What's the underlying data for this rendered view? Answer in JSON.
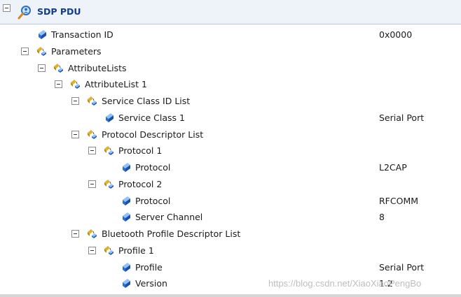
{
  "header": {
    "title": "SDP PDU"
  },
  "tree": [
    {
      "label": "Transaction ID",
      "value": "0x0000",
      "kind": "field",
      "depth": 1
    },
    {
      "label": "Parameters",
      "value": "",
      "kind": "group",
      "depth": 1
    },
    {
      "label": "AttributeLists",
      "value": "",
      "kind": "group",
      "depth": 2
    },
    {
      "label": "AttributeList 1",
      "value": "",
      "kind": "group",
      "depth": 3
    },
    {
      "label": "Service Class ID List",
      "value": "",
      "kind": "group",
      "depth": 4
    },
    {
      "label": "Service Class 1",
      "value": "Serial Port",
      "kind": "field",
      "depth": 5
    },
    {
      "label": "Protocol Descriptor List",
      "value": "",
      "kind": "group",
      "depth": 4
    },
    {
      "label": "Protocol 1",
      "value": "",
      "kind": "group",
      "depth": 5
    },
    {
      "label": "Protocol",
      "value": "L2CAP",
      "kind": "field",
      "depth": 6
    },
    {
      "label": "Protocol 2",
      "value": "",
      "kind": "group",
      "depth": 5
    },
    {
      "label": "Protocol",
      "value": "RFCOMM",
      "kind": "field",
      "depth": 6
    },
    {
      "label": "Server Channel",
      "value": "8",
      "kind": "field",
      "depth": 6
    },
    {
      "label": "Bluetooth Profile Descriptor List",
      "value": "",
      "kind": "group",
      "depth": 4
    },
    {
      "label": "Profile 1",
      "value": "",
      "kind": "group",
      "depth": 5
    },
    {
      "label": "Profile",
      "value": "Serial Port",
      "kind": "field",
      "depth": 6
    },
    {
      "label": "Version",
      "value": "1.2",
      "kind": "field",
      "depth": 6
    }
  ],
  "watermark": "https://blog.csdn.net/XiaoXiaoPengBo",
  "colors": {
    "field_icon": "#2a6fd6",
    "group_icon": "#e0b030",
    "title": "#123c8c"
  }
}
